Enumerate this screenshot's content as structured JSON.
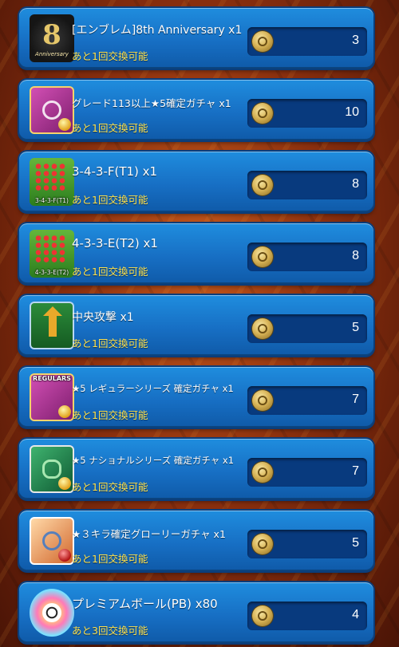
{
  "items": [
    {
      "title": "[エンブレム]8th Anniversary x1",
      "remain": "あと1回交換可能",
      "price": "3",
      "icon": "emblem-8th-icon",
      "icon_text": "8",
      "icon_caption": "Anniversary"
    },
    {
      "title": "グレード113以上★5確定ガチャ x1",
      "remain": "あと1回交換可能",
      "price": "10",
      "icon": "purple-gacha-icon"
    },
    {
      "title": "3-4-3-F(T1) x1",
      "remain": "あと1回交換可能",
      "price": "8",
      "icon": "formation-icon",
      "icon_label": "3-4-3-F(T1)"
    },
    {
      "title": "4-3-3-E(T2) x1",
      "remain": "あと1回交換可能",
      "price": "8",
      "icon": "formation-icon",
      "icon_label": "4-3-3-E(T2)"
    },
    {
      "title": "中央攻撃 x1",
      "remain": "あと1回交換可能",
      "price": "5",
      "icon": "central-attack-tactic-icon"
    },
    {
      "title": "★5 レギュラーシリーズ 確定ガチャ x1",
      "remain": "あと1回交換可能",
      "price": "7",
      "icon": "regulars-gacha-icon",
      "icon_label": "REGULARS"
    },
    {
      "title": "★5 ナショナルシリーズ 確定ガチャ x1",
      "remain": "あと1回交換可能",
      "price": "7",
      "icon": "national-gacha-icon"
    },
    {
      "title": "★３キラ確定グローリーガチャ x1",
      "remain": "あと1回交換可能",
      "price": "5",
      "icon": "glory-gacha-icon"
    },
    {
      "title": "プレミアムボール(PB) x80",
      "remain": "あと3回交換可能",
      "price": "4",
      "icon": "premium-ball-icon"
    }
  ],
  "currency_icon": "exchange-coin-icon"
}
